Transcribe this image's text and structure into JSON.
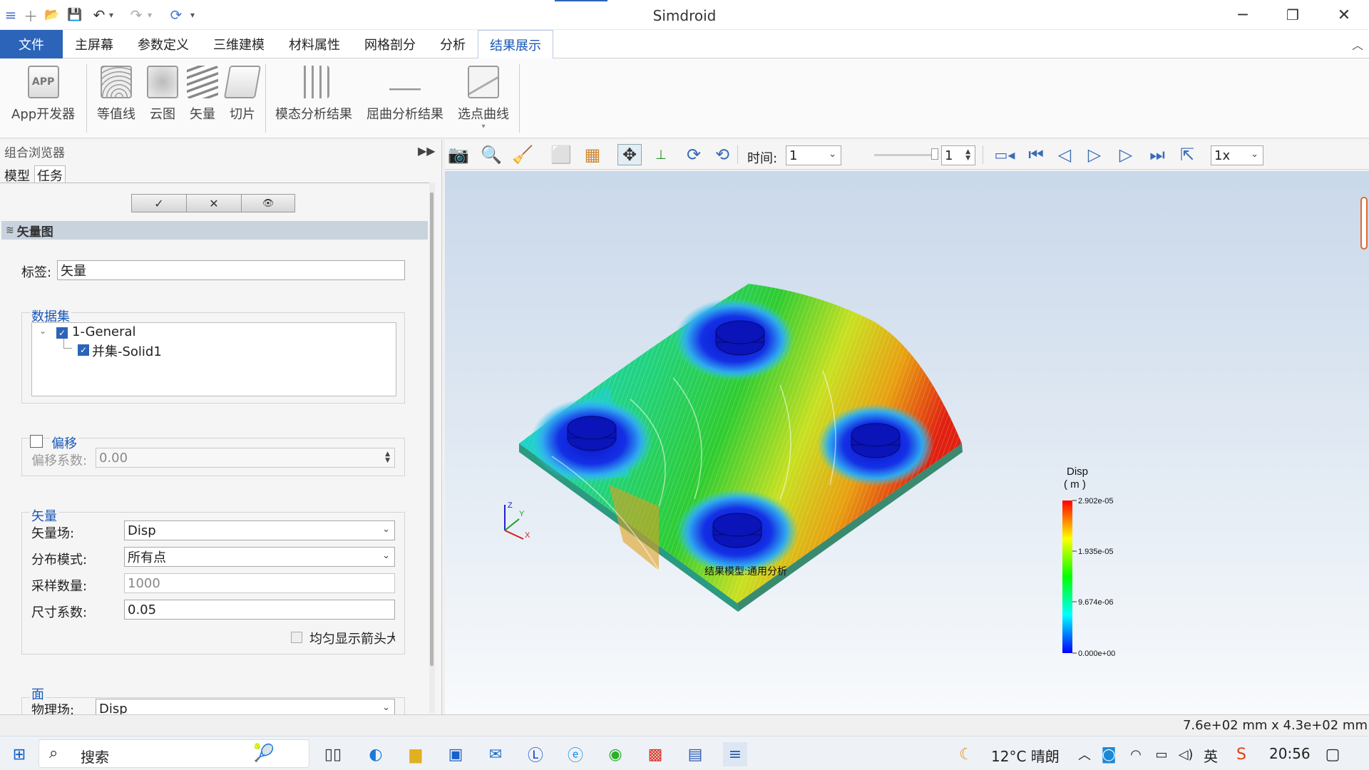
{
  "window": {
    "title": "Simdroid",
    "min": "─",
    "max": "❐",
    "close": "✕"
  },
  "qat": [
    "≡",
    "＋",
    "📂",
    "💾",
    "↶",
    "▾",
    "↷",
    "▾",
    "⟳",
    "▾"
  ],
  "menu": [
    "文件",
    "主屏幕",
    "参数定义",
    "三维建模",
    "材料属性",
    "网格剖分",
    "分析",
    "结果展示"
  ],
  "ribbon": {
    "app": "App开发器",
    "contour": "等值线",
    "cloud": "云图",
    "vector": "矢量",
    "slice": "切片",
    "modal": "模态分析结果",
    "buckling": "屈曲分析结果",
    "pick_curve": "选点曲线"
  },
  "panel": {
    "title": "组合浏览器",
    "tabs": [
      "模型",
      "任务"
    ],
    "ok": "✓",
    "cancel": "✕",
    "eye": "👁",
    "section": "矢量图",
    "label_lbl": "标签:",
    "label_val": "矢量",
    "dataset_title": "数据集",
    "tree": [
      "1-General",
      "并集-Solid1"
    ],
    "offset_title": "偏移",
    "offset_coef_lbl": "偏移系数:",
    "offset_coef_val": "0.00",
    "vector_title": "矢量",
    "field_lbl": "矢量场:",
    "field_val": "Disp",
    "mode_lbl": "分布模式:",
    "mode_val": "所有点",
    "count_lbl": "采样数量:",
    "count_val": "1000",
    "size_lbl": "尺寸系数:",
    "size_val": "0.05",
    "uniform_lbl": "均匀显示箭头大",
    "face_title": "面",
    "phys_lbl": "物理场:",
    "phys_val": "Disp"
  },
  "viewtb": {
    "time_lbl": "时间:",
    "time_val": "1",
    "frame_val": "1",
    "speed_val": "1x"
  },
  "viewport": {
    "legend_title": "Disp",
    "legend_unit": "( m )",
    "legend_ticks": [
      "2.902e-05",
      "1.935e-05",
      "9.674e-06",
      "0.000e+00"
    ],
    "model_label": "结果模型:通用分析",
    "axes": {
      "z": "Z",
      "y": "Y",
      "x": "X"
    }
  },
  "status": {
    "dims": "7.6e+02 mm x 4.3e+02 mm"
  },
  "taskbar": {
    "search": "搜索",
    "weather": "12°C 晴朗",
    "ime": "英",
    "time": "20:56"
  },
  "colors": {
    "accent": "#2b64b8",
    "legend": [
      "#ff0000",
      "#ffff00",
      "#00ff00",
      "#00ffff",
      "#0000ff"
    ]
  }
}
